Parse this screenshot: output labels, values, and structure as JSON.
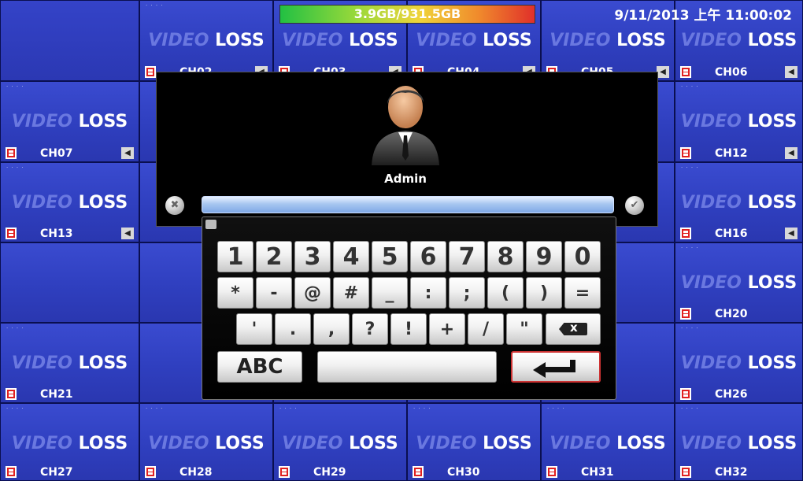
{
  "status": {
    "storage": "3.9GB/931.5GB",
    "datetime": "9/11/2013 上午 11:00:02"
  },
  "video_loss_label": "LOSS",
  "video_loss_prefix": "VIDEO",
  "tiles": [
    {
      "ch": "CH02"
    },
    {
      "ch": "CH03"
    },
    {
      "ch": "CH04"
    },
    {
      "ch": "CH05"
    },
    {
      "ch": "CH06"
    },
    {
      "ch": "CH07"
    },
    {
      "ch": "CH12"
    },
    {
      "ch": "CH13"
    },
    {
      "ch": "CH16"
    },
    {
      "ch": "CH20"
    },
    {
      "ch": "CH21"
    },
    {
      "ch": "CH26"
    },
    {
      "ch": "CH27"
    },
    {
      "ch": "CH28"
    },
    {
      "ch": "CH29"
    },
    {
      "ch": "CH30"
    },
    {
      "ch": "CH31"
    },
    {
      "ch": "CH32"
    }
  ],
  "login": {
    "username": "Admin",
    "password_value": ""
  },
  "keyboard": {
    "row1": [
      "1",
      "2",
      "3",
      "4",
      "5",
      "6",
      "7",
      "8",
      "9",
      "0"
    ],
    "row2": [
      "*",
      "-",
      "@",
      "#",
      "_",
      ":",
      ";",
      "(",
      ")",
      "="
    ],
    "row3": [
      "'",
      ".",
      ",",
      "?",
      "!",
      "+",
      "/",
      "\""
    ],
    "abc_label": "ABC",
    "space_label": ""
  },
  "icons": {
    "cancel": "close-circle-icon",
    "confirm": "check-circle-icon",
    "backspace": "backspace-icon",
    "enter": "enter-icon",
    "camera": "camera-recording-icon",
    "speaker": "speaker-icon",
    "user": "user-avatar-icon"
  }
}
